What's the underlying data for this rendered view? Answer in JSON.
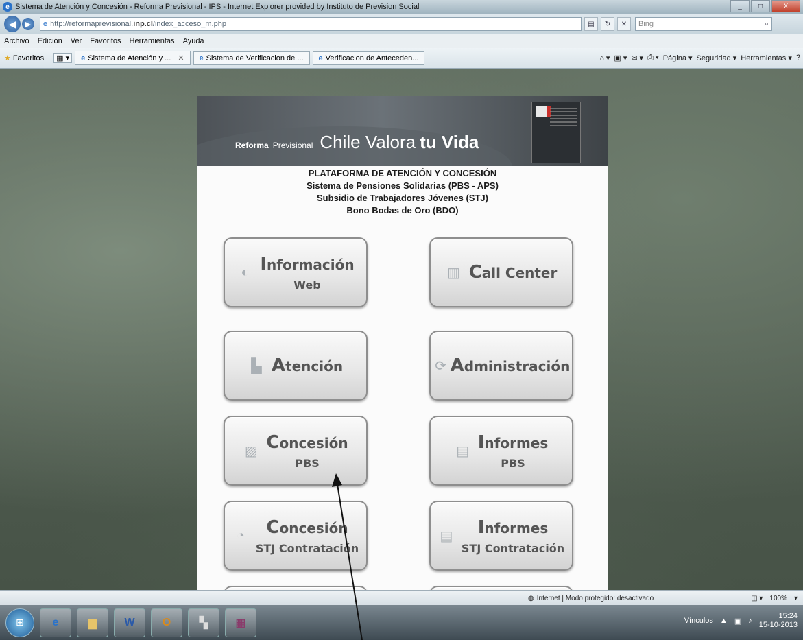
{
  "window": {
    "title": "Sistema de Atención y Concesión - Reforma Previsional - IPS - Internet Explorer provided by Instituto de Prevision Social"
  },
  "address_bar": {
    "url_prefix": "http://reformaprevisional.",
    "url_domain": "inp.cl",
    "url_suffix": "/index_acceso_m.php",
    "search_placeholder": "Bing"
  },
  "menu": [
    "Archivo",
    "Edición",
    "Ver",
    "Favoritos",
    "Herramientas",
    "Ayuda"
  ],
  "favorites_bar": {
    "favorites_label": "Favoritos",
    "tabs": [
      "Sistema de Atención y ...",
      "Sistema de Verificacion de ...",
      "Verificacion de Anteceden..."
    ],
    "command_items": [
      "Página ▾",
      "Seguridad ▾",
      "Herramientas ▾"
    ]
  },
  "banner": {
    "reforma": "Reforma",
    "previsional": "Previsional",
    "chile_valora": "Chile Valora",
    "tu_vida": "tu Vida"
  },
  "headings": [
    "PLATAFORMA DE ATENCIÓN Y CONCESIÓN",
    "Sistema de Pensiones Solidarias (PBS - APS)",
    "Subsidio de Trabajadores Jóvenes (STJ)",
    "Bono Bodas de Oro (BDO)"
  ],
  "buttons": {
    "info_web": {
      "cap": "I",
      "rest": "nformación",
      "line2": "Web",
      "icon": "globe-icon"
    },
    "call_center": {
      "cap": "C",
      "rest": "all Center",
      "icon": "phone-icon"
    },
    "atencion": {
      "cap": "A",
      "rest": "tención",
      "icon": "desk-icon"
    },
    "administracion": {
      "cap": "A",
      "rest": "dministración",
      "icon": "gear-icon"
    },
    "concesion_pbs": {
      "cap": "C",
      "rest": "oncesión",
      "line2": "PBS",
      "icon": "document-icon"
    },
    "informes_pbs": {
      "cap": "I",
      "rest": "nformes",
      "line2": "PBS",
      "icon": "report-icon"
    },
    "concesion_stj": {
      "cap": "C",
      "rest": "oncesión",
      "line2": "STJ Contratación",
      "icon": "document-icon"
    },
    "informes_stj": {
      "cap": "I",
      "rest": "nformes",
      "line2": "STJ Contratación",
      "icon": "report-icon"
    }
  },
  "status_bar": {
    "zone_text": "Internet | Modo protegido: desactivado",
    "zoom": "100%"
  },
  "taskbar": {
    "items": [
      "ie",
      "folder",
      "W",
      "Outlook",
      "paint",
      "winrar"
    ],
    "links_label": "Vínculos",
    "time": "15:24",
    "date": "15-10-2013"
  }
}
